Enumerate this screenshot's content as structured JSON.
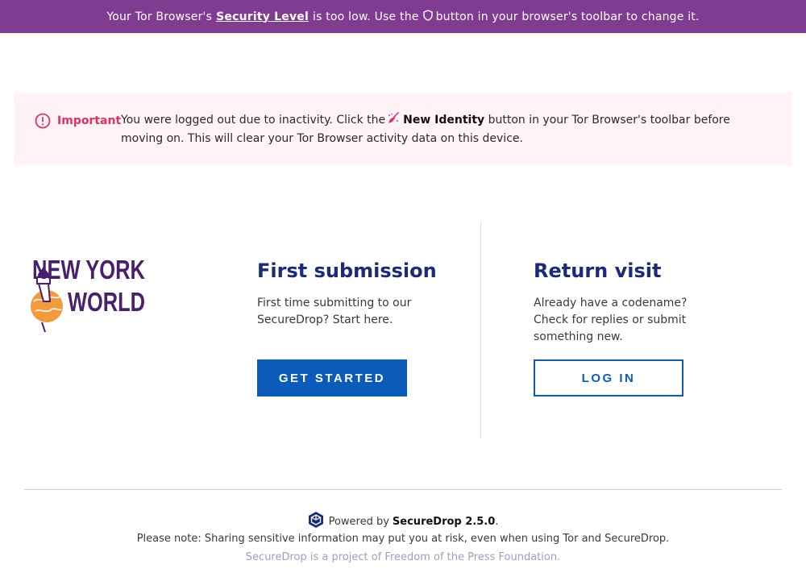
{
  "security_banner": {
    "prefix": "Your Tor Browser's",
    "link": "Security Level",
    "middle": "is too low. Use the",
    "suffix": "button in your browser's toolbar to change it.",
    "icon": "shield-icon",
    "color": "#803c90"
  },
  "notice": {
    "label": "Important",
    "icon": "alert-circle-icon",
    "text_before": "You were logged out due to inactivity. Click the",
    "button_name": "New Identity",
    "text_after": "button in your Tor Browser's toolbar before moving on. This will clear your Tor Browser activity data on this device.",
    "inline_icon": "broom-icon",
    "background": "#fff3f6",
    "accent": "#e0315f"
  },
  "logo": {
    "line1": "NEW YORK",
    "line2": "WORLD",
    "color": "#4a1f6e"
  },
  "first_submission": {
    "heading": "First submission",
    "description": "First time submitting to our SecureDrop? Start here.",
    "button": "GET STARTED"
  },
  "return_visit": {
    "heading": "Return visit",
    "description": "Already have a codename? Check for replies or submit something new.",
    "button": "LOG IN"
  },
  "footer": {
    "powered_by": "Powered by",
    "product": "SecureDrop 2.5.0",
    "period": ".",
    "note": "Please note: Sharing sensitive information may put you at risk, even when using Tor and SecureDrop.",
    "fpf": "SecureDrop is a project of Freedom of the Press Foundation.",
    "logo_icon": "securedrop-logo-icon"
  },
  "colors": {
    "heading": "#1a2a7c",
    "primary": "#0b5bbb"
  }
}
